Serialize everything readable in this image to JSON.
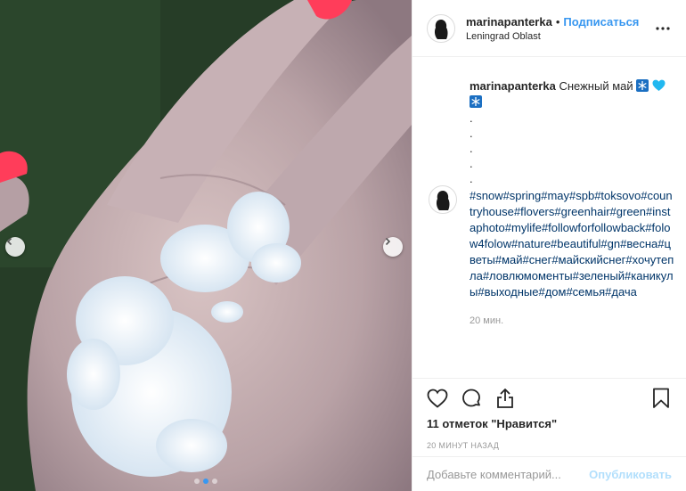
{
  "post": {
    "username": "marinapanterka",
    "separator": "•",
    "follow_label": "Подписаться",
    "location": "Leningrad Oblast",
    "more_icon": "more-options-icon"
  },
  "caption": {
    "username": "marinapanterka",
    "text": "Снежный май",
    "dots": [
      ".",
      ".",
      ".",
      ".",
      "."
    ],
    "hashtags": "#snow#spring#may#spb#toksovo#countryhouse#flovers#greenhair#green#instaphoto#mylife#followforfollowback#folow4folow#nature#beautiful#gn#весна#цветы#май#снег#майскийснег#хочутепла#ловлюмоменты#зеленый#каникулы#выходные#дом#семья#дача",
    "time_ago": "20 мин."
  },
  "actions": {
    "likes": "11 отметок \"Нравится\"",
    "timestamp": "20 минут назад"
  },
  "comment": {
    "placeholder": "Добавьте комментарий...",
    "publish_label": "Опубликовать"
  },
  "carousel": {
    "slide_count": 3,
    "active_index": 1
  },
  "colors": {
    "link": "#3897f0",
    "hashtag": "#003569",
    "publish_disabled": "#b2dffc"
  }
}
